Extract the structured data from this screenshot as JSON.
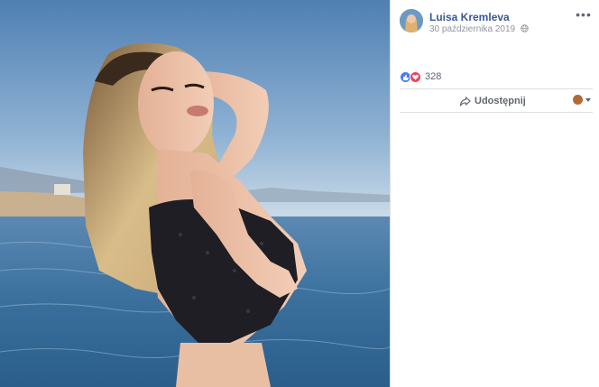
{
  "post": {
    "author": "Luisa Kremleva",
    "date": "30 października 2019",
    "audience_icon": "globe-icon",
    "more_icon": "more-options-icon",
    "more_label": "•••"
  },
  "reactions": {
    "icons": [
      "like-icon",
      "love-icon"
    ],
    "count": "328"
  },
  "actions": {
    "share_label": "Udostępnij",
    "share_icon": "share-arrow-icon"
  },
  "colors": {
    "author_link": "#385898",
    "meta_text": "#90949c",
    "like": "#4a7cf6",
    "love": "#f0415f",
    "divider": "#dddfe2"
  }
}
